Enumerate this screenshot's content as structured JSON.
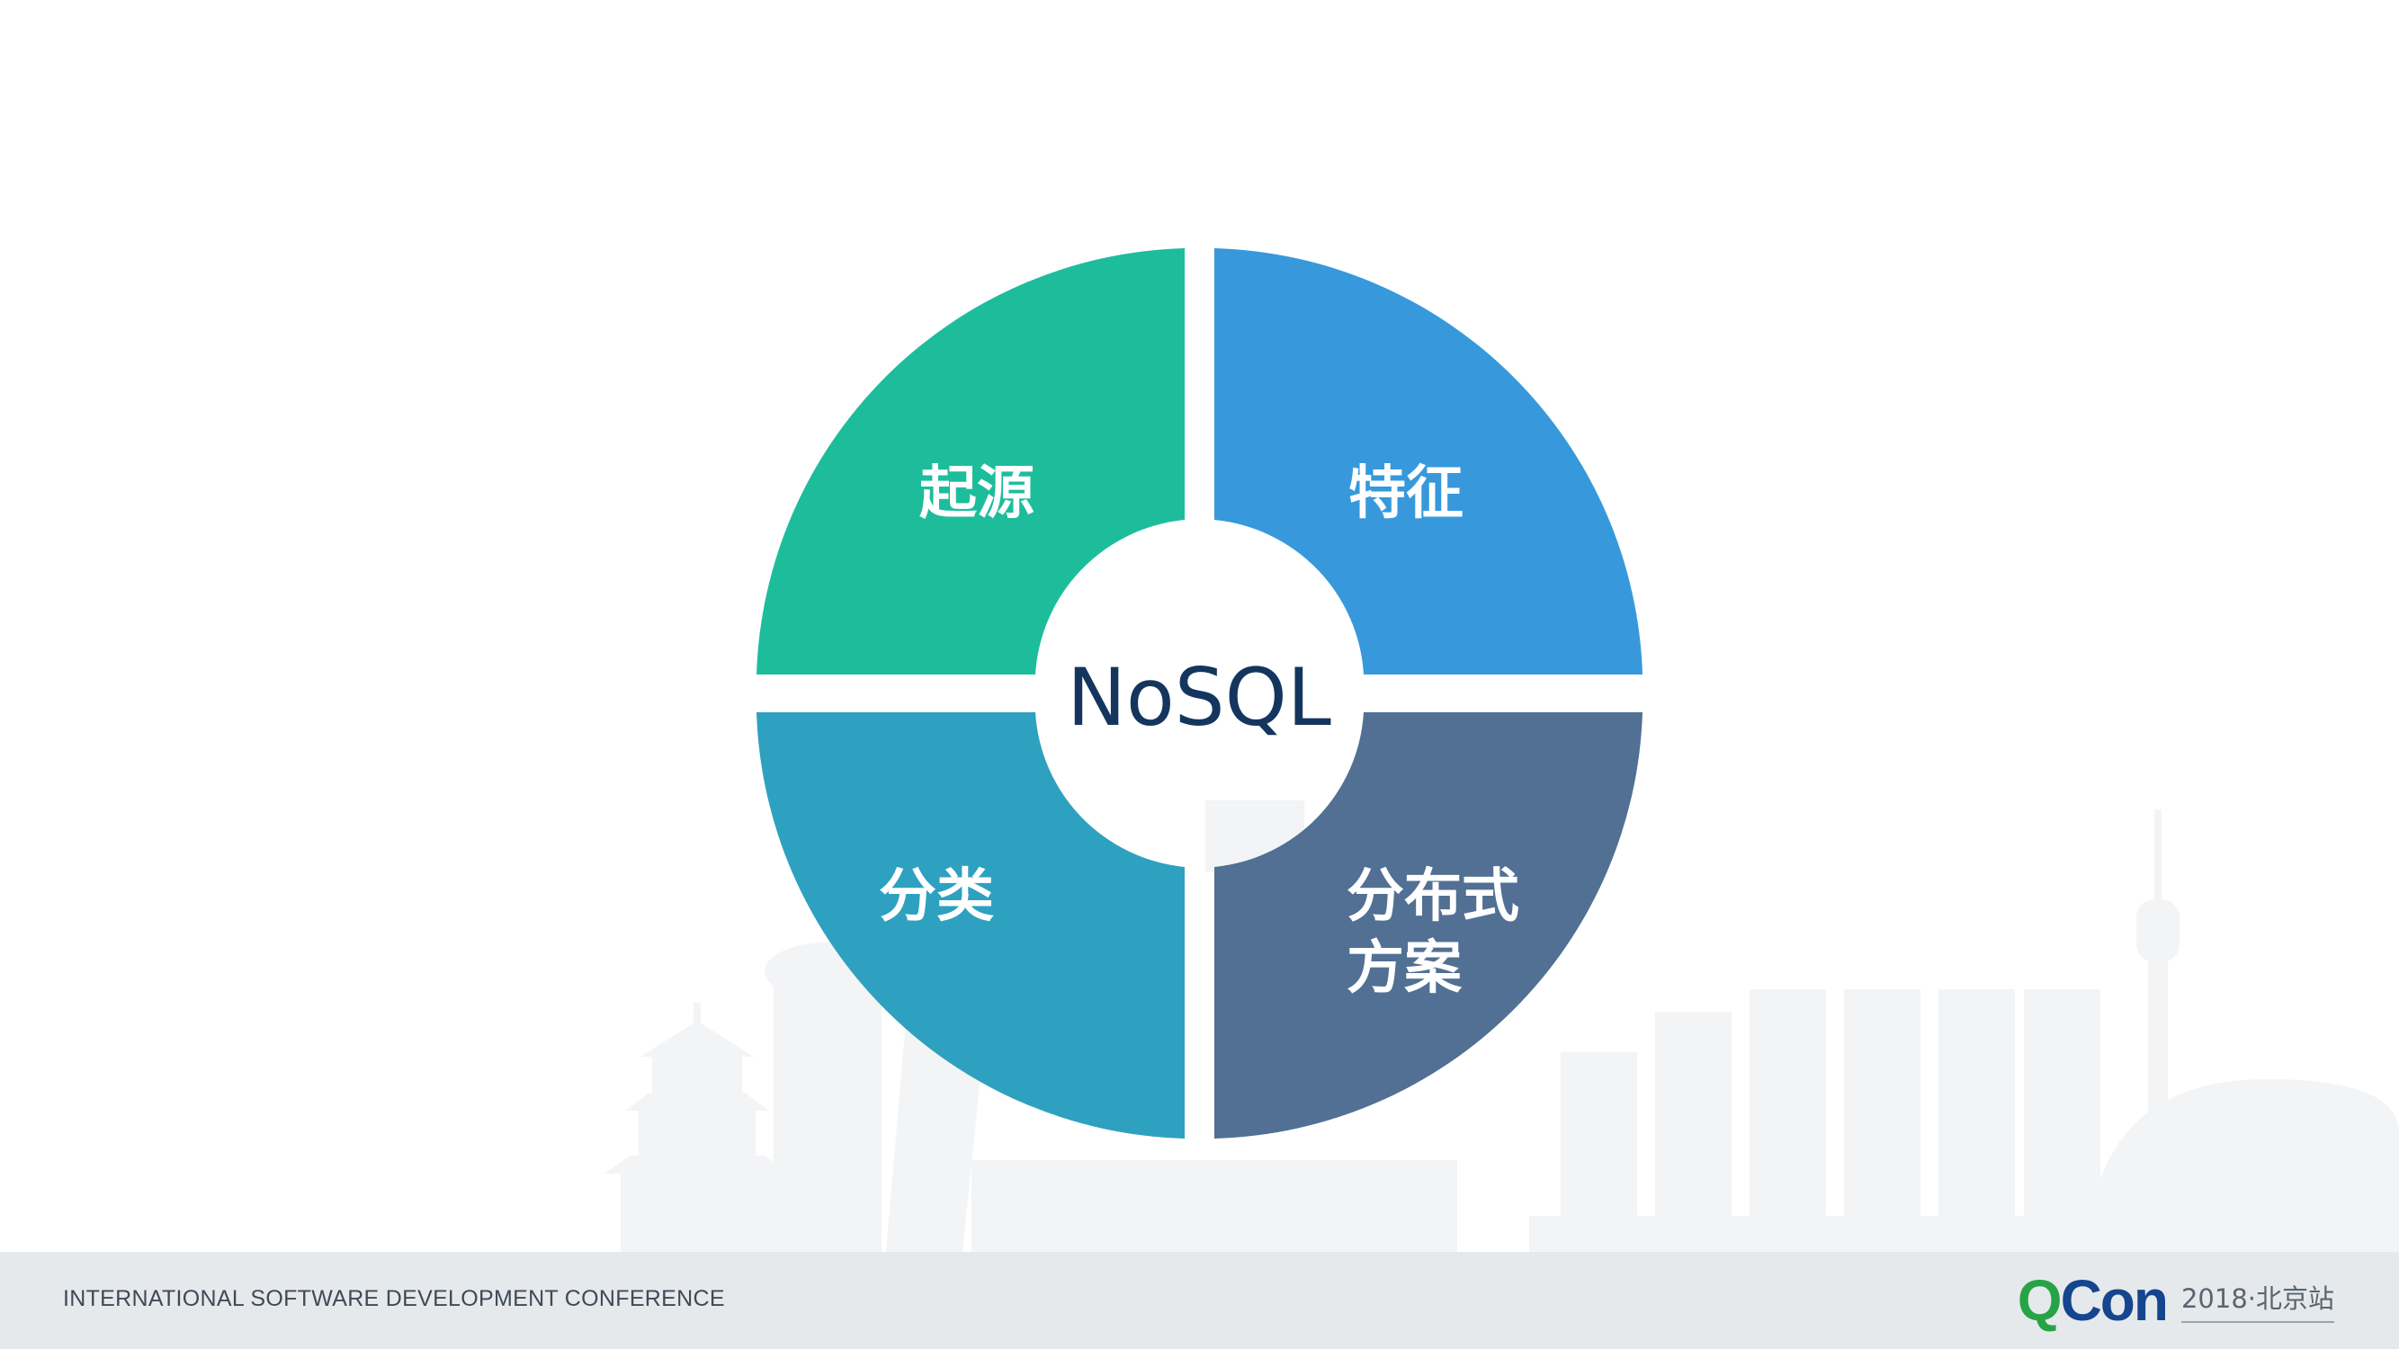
{
  "diagram": {
    "center_label": "NoSQL",
    "quadrants": [
      {
        "id": "top-left",
        "lines": [
          "起源"
        ],
        "color": "#1dbd9c"
      },
      {
        "id": "top-right",
        "lines": [
          "特征"
        ],
        "color": "#3799dc"
      },
      {
        "id": "bottom-left",
        "lines": [
          "分类"
        ],
        "color": "#2ea1c0"
      },
      {
        "id": "bottom-right",
        "lines": [
          "分布式",
          "方案"
        ],
        "color": "#517093"
      }
    ]
  },
  "footer": {
    "conference_name": "INTERNATIONAL SOFTWARE DEVELOPMENT CONFERENCE",
    "brand_q": "Q",
    "brand_con": "Con",
    "edition": "2018·北京站"
  },
  "colors": {
    "center_text": "#14365e",
    "footer_bg": "#e6e9ec",
    "brand_green": "#27a346",
    "brand_blue": "#16458f",
    "skyline": "#f3f4f6"
  }
}
